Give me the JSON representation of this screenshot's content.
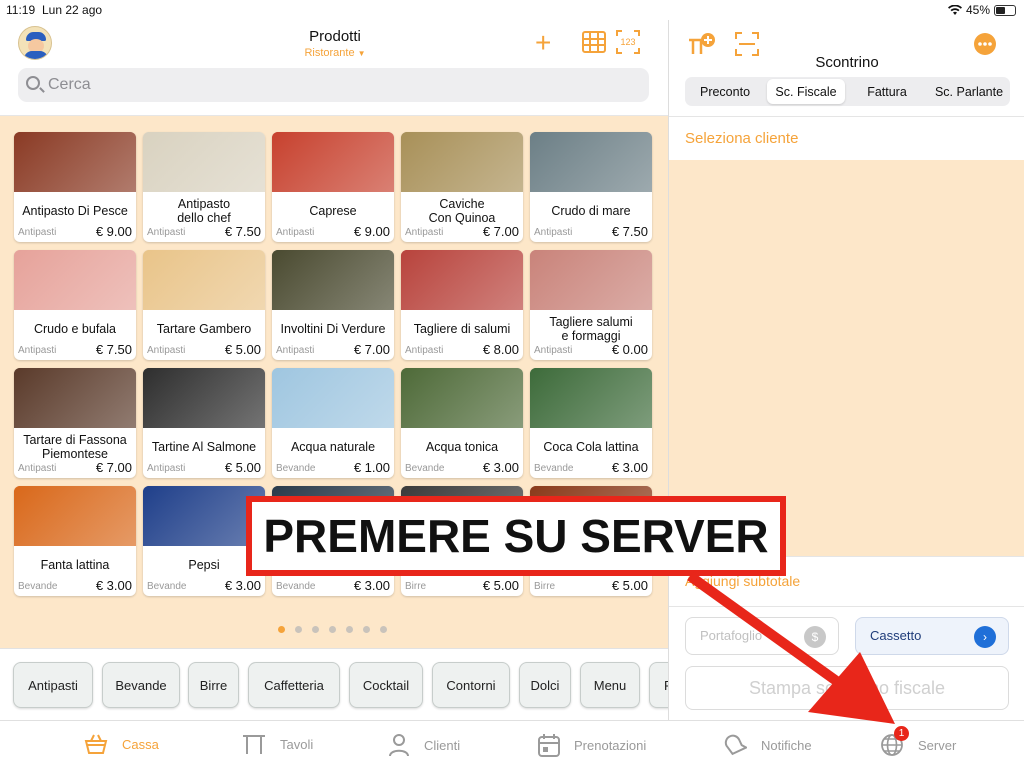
{
  "status": {
    "time": "11:19",
    "date": "Lun 22 ago",
    "battery": "45%"
  },
  "header": {
    "title": "Prodotti",
    "subtitle": "Ristorante",
    "dropdown_caret": "▼",
    "add_label": "+"
  },
  "search": {
    "placeholder": "Cerca"
  },
  "products": [
    {
      "name": "Antipasto Di Pesce",
      "category": "Antipasti",
      "price": "€ 9.00",
      "color": "#8a3a24"
    },
    {
      "name": "Antipasto\ndello chef",
      "category": "Antipasti",
      "price": "€ 7.50",
      "color": "#d9d2c0"
    },
    {
      "name": "Caprese",
      "category": "Antipasti",
      "price": "€ 9.00",
      "color": "#c7412e"
    },
    {
      "name": "Caviche\nCon Quinoa",
      "category": "Antipasti",
      "price": "€ 7.00",
      "color": "#a89058"
    },
    {
      "name": "Crudo di mare",
      "category": "Antipasti",
      "price": "€ 7.50",
      "color": "#6c7f86"
    },
    {
      "name": "Crudo e bufala",
      "category": "Antipasti",
      "price": "€ 7.50",
      "color": "#e6a29a"
    },
    {
      "name": "Tartare Gambero",
      "category": "Antipasti",
      "price": "€ 5.00",
      "color": "#e9c489"
    },
    {
      "name": "Involtini Di Verdure",
      "category": "Antipasti",
      "price": "€ 7.00",
      "color": "#4a4a30"
    },
    {
      "name": "Tagliere di salumi",
      "category": "Antipasti",
      "price": "€ 8.00",
      "color": "#b8433c"
    },
    {
      "name": "Tagliere salumi\ne formaggi",
      "category": "Antipasti",
      "price": "€ 0.00",
      "color": "#c9837a"
    },
    {
      "name": "Tartare di Fassona\nPiemontese",
      "category": "Antipasti",
      "price": "€ 7.00",
      "color": "#5a3a2a"
    },
    {
      "name": "Tartine Al Salmone",
      "category": "Antipasti",
      "price": "€ 5.00",
      "color": "#2e2e2e"
    },
    {
      "name": "Acqua naturale",
      "category": "Bevande",
      "price": "€ 1.00",
      "color": "#9fc6e0"
    },
    {
      "name": "Acqua tonica",
      "category": "Bevande",
      "price": "€ 3.00",
      "color": "#4e6a38"
    },
    {
      "name": "Coca Cola lattina",
      "category": "Bevande",
      "price": "€ 3.00",
      "color": "#3d6b3a"
    },
    {
      "name": "Fanta lattina",
      "category": "Bevande",
      "price": "€ 3.00",
      "color": "#d9681a"
    },
    {
      "name": "Pepsi",
      "category": "Bevande",
      "price": "€ 3.00",
      "color": "#1f3f8a"
    },
    {
      "name": "",
      "category": "Bevande",
      "price": "€ 3.00",
      "color": "#2a3a4a"
    },
    {
      "name": "",
      "category": "Birre",
      "price": "€ 5.00",
      "color": "#3a3a3a"
    },
    {
      "name": "",
      "category": "Birre",
      "price": "€ 5.00",
      "color": "#8a3a1a"
    }
  ],
  "categories": [
    "Antipasti",
    "Bevande",
    "Birre",
    "Caffetteria",
    "Cocktail",
    "Contorni",
    "Dolci",
    "Menu",
    "P"
  ],
  "receipt": {
    "title": "Scontrino",
    "segments": [
      "Preconto",
      "Sc. Fiscale",
      "Fattura",
      "Sc. Parlante"
    ],
    "select_customer": "Seleziona cliente",
    "subtotal": "Aggiungi subtotale",
    "wallet": "Portafoglio",
    "drawer": "Cassetto",
    "print": "Stampa scontrino fiscale"
  },
  "tabs": [
    {
      "label": "Cassa",
      "icon": "basket-icon"
    },
    {
      "label": "Tavoli",
      "icon": "table-icon"
    },
    {
      "label": "Clienti",
      "icon": "person-icon"
    },
    {
      "label": "Prenotazioni",
      "icon": "calendar-icon"
    },
    {
      "label": "Notifiche",
      "icon": "bell-icon"
    },
    {
      "label": "Server",
      "icon": "globe-icon",
      "badge": "1"
    }
  ],
  "overlay": {
    "text": "PREMERE SU SERVER"
  },
  "colors": {
    "accent": "#f5a33a",
    "overlay_red": "#e8261a",
    "grid_bg": "#fde7c9"
  }
}
